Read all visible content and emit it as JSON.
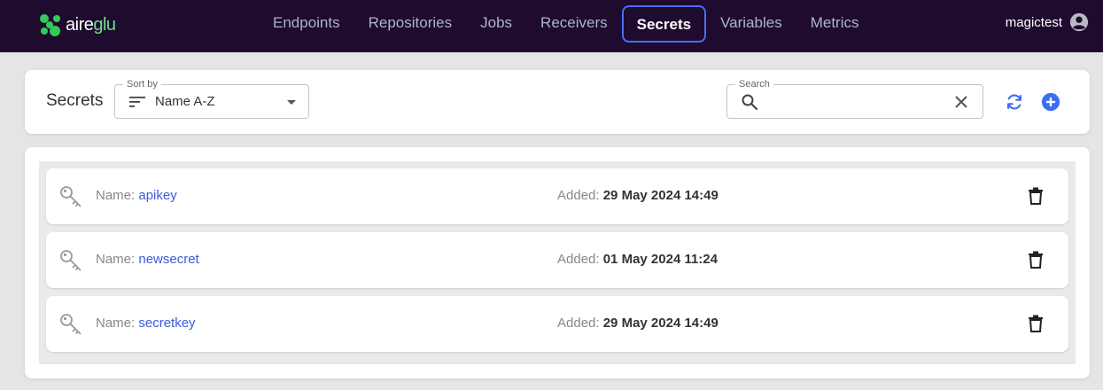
{
  "brand": {
    "logo_prefix": "aire",
    "logo_suffix": "glu",
    "accent": "#4a6cf7",
    "logo_color": "#35c85a"
  },
  "nav": {
    "items": [
      {
        "label": "Endpoints"
      },
      {
        "label": "Repositories"
      },
      {
        "label": "Jobs"
      },
      {
        "label": "Receivers"
      },
      {
        "label": "Secrets",
        "active": true
      },
      {
        "label": "Variables"
      },
      {
        "label": "Metrics"
      }
    ]
  },
  "user": {
    "name": "magictest",
    "icon": "account-circle-icon"
  },
  "header": {
    "title": "Secrets",
    "sort": {
      "legend": "Sort by",
      "value": "Name A-Z",
      "icon": "sort-lines-icon"
    },
    "search": {
      "legend": "Search",
      "value": "",
      "placeholder": ""
    },
    "actions": {
      "refresh_icon": "refresh-icon",
      "add_icon": "add-circle-icon"
    }
  },
  "secrets": [
    {
      "name_label": "Name: ",
      "name": "apikey",
      "added_label": "Added: ",
      "added": "29 May 2024 14:49"
    },
    {
      "name_label": "Name: ",
      "name": "newsecret",
      "added_label": "Added: ",
      "added": "01 May 2024 11:24"
    },
    {
      "name_label": "Name: ",
      "name": "secretkey",
      "added_label": "Added: ",
      "added": "29 May 2024 14:49"
    }
  ]
}
